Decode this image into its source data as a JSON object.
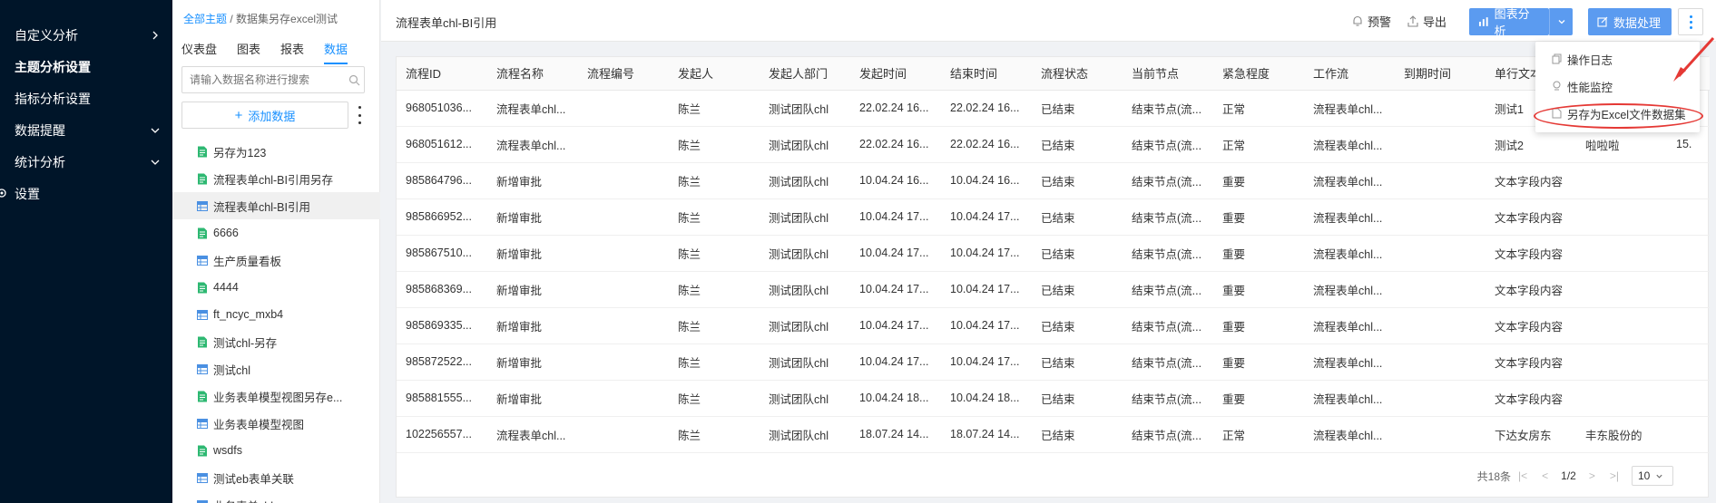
{
  "nav": {
    "items": [
      {
        "label": "自定义分析",
        "chev": "right"
      },
      {
        "label": "主题分析设置",
        "chev": ""
      },
      {
        "label": "指标分析设置",
        "chev": ""
      },
      {
        "label": "数据提醒",
        "chev": "down"
      },
      {
        "label": "统计分析",
        "chev": "down"
      },
      {
        "label": "设置",
        "chev": ""
      }
    ]
  },
  "panel": {
    "crumb_link": "全部主题",
    "crumb_sep": " / ",
    "crumb_current": "数据集另存excel测试",
    "tabs": [
      "仪表盘",
      "图表",
      "报表",
      "数据"
    ],
    "search_placeholder": "请输入数据名称进行搜索",
    "add_label": "添加数据",
    "datasets": [
      {
        "label": "另存为123",
        "type": "excel"
      },
      {
        "label": "流程表单chl-BI引用另存",
        "type": "excel"
      },
      {
        "label": "流程表单chl-BI引用",
        "type": "table"
      },
      {
        "label": "6666",
        "type": "excel"
      },
      {
        "label": "生产质量看板",
        "type": "table"
      },
      {
        "label": "4444",
        "type": "excel"
      },
      {
        "label": "ft_ncyc_mxb4",
        "type": "table"
      },
      {
        "label": "测试chl-另存",
        "type": "excel"
      },
      {
        "label": "测试chl",
        "type": "table"
      },
      {
        "label": "业务表单模型视图另存e...",
        "type": "excel"
      },
      {
        "label": "业务表单模型视图",
        "type": "table"
      },
      {
        "label": "wsdfs",
        "type": "excel"
      },
      {
        "label": "测试eb表单关联",
        "type": "table"
      },
      {
        "label": "业务表单chl",
        "type": "table"
      }
    ]
  },
  "header": {
    "title": "流程表单chl-BI引用",
    "alert_label": "预警",
    "export_label": "导出",
    "chart_analysis_label": "图表分析",
    "data_process_label": "数据处理"
  },
  "table": {
    "columns": [
      "流程ID",
      "流程名称",
      "流程编号",
      "发起人",
      "发起人部门",
      "发起时间",
      "结束时间",
      "流程状态",
      "当前节点",
      "紧急程度",
      "工作流",
      "到期时间",
      "单行文本",
      "",
      ""
    ],
    "rows": [
      [
        "968051036...",
        "流程表单chl...",
        "",
        "陈兰",
        "测试团队chl",
        "22.02.24 16...",
        "22.02.24 16...",
        "已结束",
        "结束节点(流...",
        "正常",
        "流程表单chl...",
        "",
        "测试1",
        "",
        ""
      ],
      [
        "968051612...",
        "流程表单chl...",
        "",
        "陈兰",
        "测试团队chl",
        "22.02.24 16...",
        "22.02.24 16...",
        "已结束",
        "结束节点(流...",
        "正常",
        "流程表单chl...",
        "",
        "测试2",
        "啦啦啦",
        "15."
      ],
      [
        "985864796...",
        "新增审批",
        "",
        "陈兰",
        "测试团队chl",
        "10.04.24 16...",
        "10.04.24 16...",
        "已结束",
        "结束节点(流...",
        "重要",
        "流程表单chl...",
        "",
        "文本字段内容",
        "",
        ""
      ],
      [
        "985866952...",
        "新增审批",
        "",
        "陈兰",
        "测试团队chl",
        "10.04.24 17...",
        "10.04.24 17...",
        "已结束",
        "结束节点(流...",
        "重要",
        "流程表单chl...",
        "",
        "文本字段内容",
        "",
        ""
      ],
      [
        "985867510...",
        "新增审批",
        "",
        "陈兰",
        "测试团队chl",
        "10.04.24 17...",
        "10.04.24 17...",
        "已结束",
        "结束节点(流...",
        "重要",
        "流程表单chl...",
        "",
        "文本字段内容",
        "",
        ""
      ],
      [
        "985868369...",
        "新增审批",
        "",
        "陈兰",
        "测试团队chl",
        "10.04.24 17...",
        "10.04.24 17...",
        "已结束",
        "结束节点(流...",
        "重要",
        "流程表单chl...",
        "",
        "文本字段内容",
        "",
        ""
      ],
      [
        "985869335...",
        "新增审批",
        "",
        "陈兰",
        "测试团队chl",
        "10.04.24 17...",
        "10.04.24 17...",
        "已结束",
        "结束节点(流...",
        "重要",
        "流程表单chl...",
        "",
        "文本字段内容",
        "",
        ""
      ],
      [
        "985872522...",
        "新增审批",
        "",
        "陈兰",
        "测试团队chl",
        "10.04.24 17...",
        "10.04.24 17...",
        "已结束",
        "结束节点(流...",
        "重要",
        "流程表单chl...",
        "",
        "文本字段内容",
        "",
        ""
      ],
      [
        "985881555...",
        "新增审批",
        "",
        "陈兰",
        "测试团队chl",
        "10.04.24 18...",
        "10.04.24 18...",
        "已结束",
        "结束节点(流...",
        "重要",
        "流程表单chl...",
        "",
        "文本字段内容",
        "",
        ""
      ],
      [
        "102256557...",
        "流程表单chl...",
        "",
        "陈兰",
        "测试团队chl",
        "18.07.24 14...",
        "18.07.24 14...",
        "已结束",
        "结束节点(流...",
        "正常",
        "流程表单chl...",
        "",
        "下达女房东",
        "丰东股份的",
        ""
      ]
    ]
  },
  "pager": {
    "total": "共18条",
    "page": "1/2",
    "page_size": "10"
  },
  "menu": {
    "items": [
      {
        "label": "操作日志",
        "icon": "copy-icon"
      },
      {
        "label": "性能监控",
        "icon": "location-icon"
      },
      {
        "label": "另存为Excel文件数据集",
        "icon": "file-icon"
      }
    ]
  },
  "colors": {
    "nav_bg": "#001529",
    "primary": "#1890ff",
    "button_blue": "#5b9bf0",
    "annotation_red": "#e53935"
  }
}
